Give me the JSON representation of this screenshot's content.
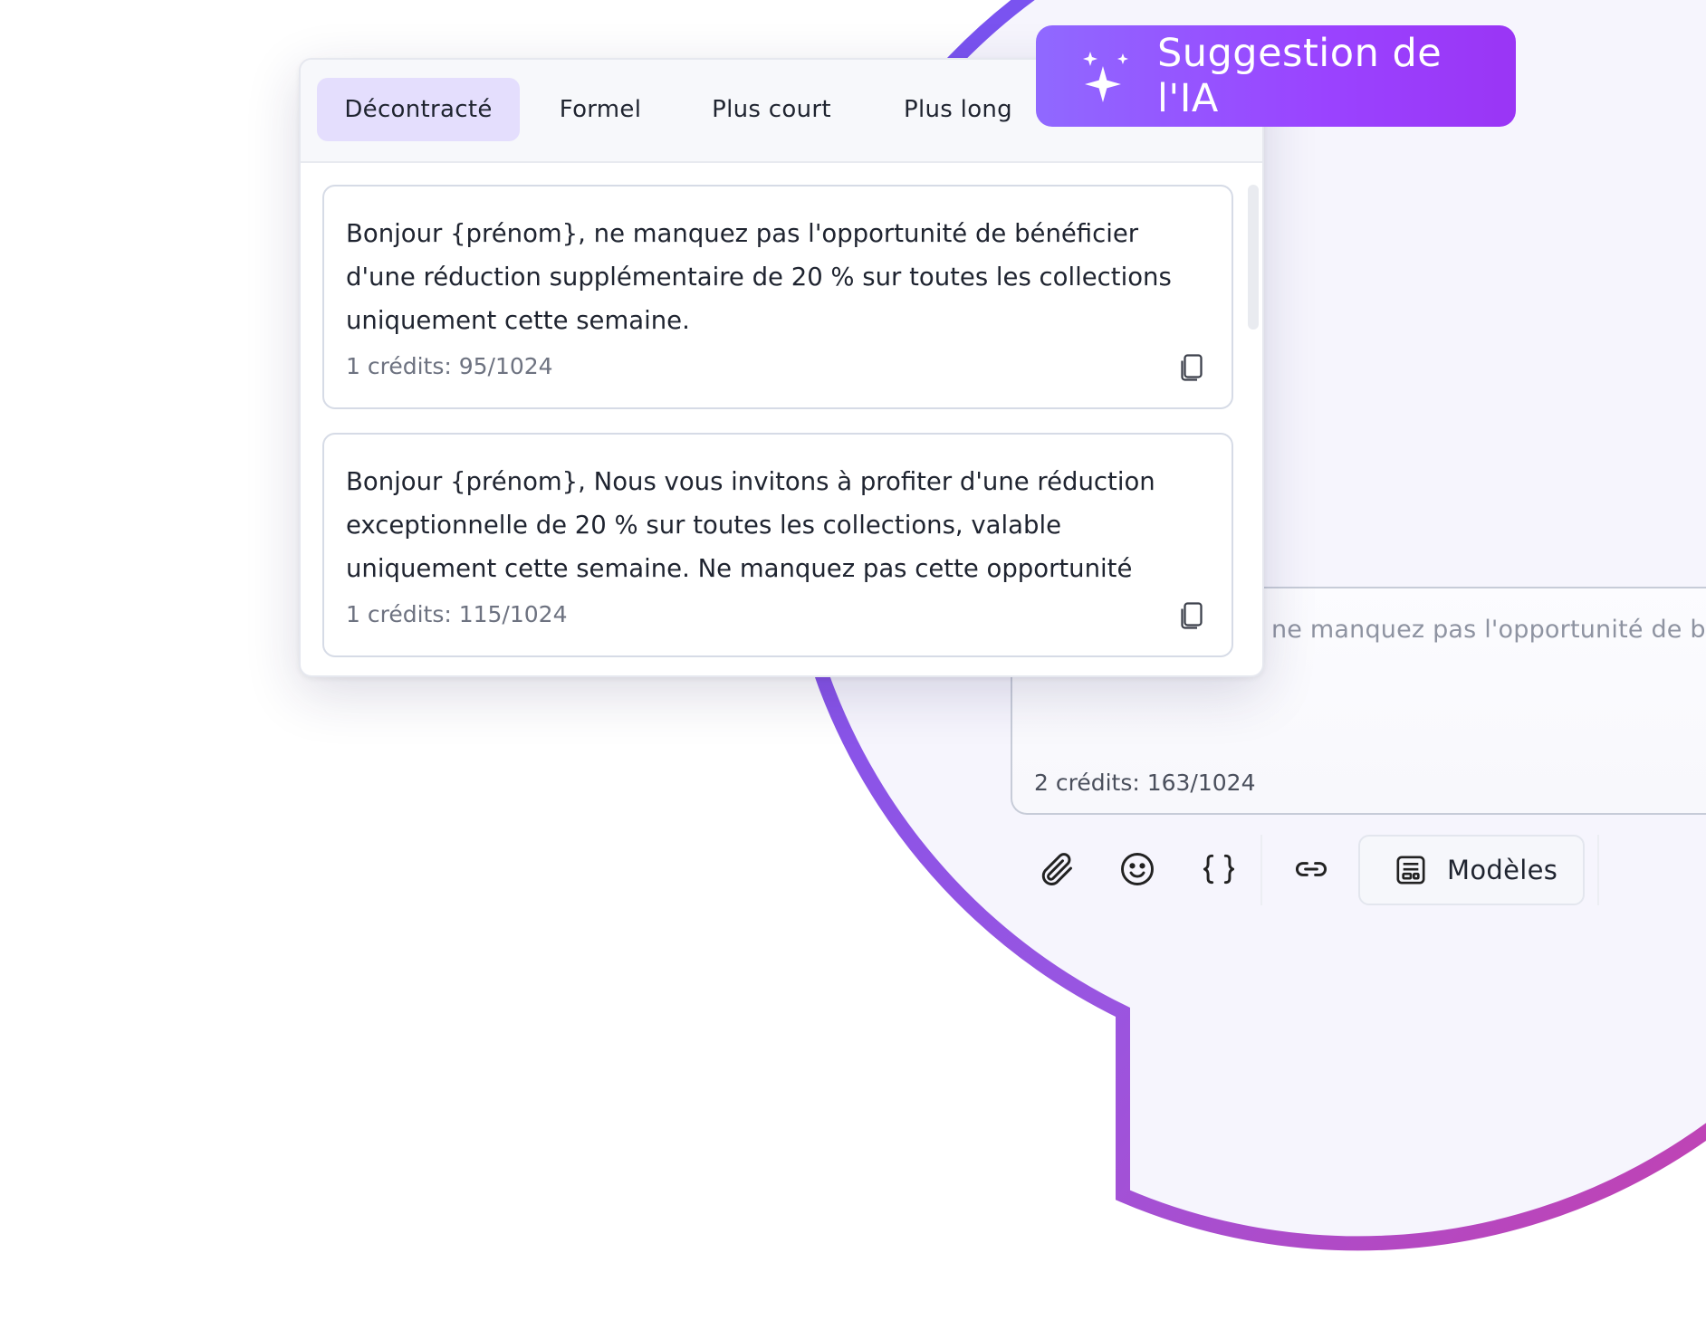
{
  "ai_badge": {
    "label": "Suggestion de l'IA",
    "icon": "sparkles-icon"
  },
  "tabs": [
    {
      "label": "Décontracté",
      "active": true
    },
    {
      "label": "Formel",
      "active": false
    },
    {
      "label": "Plus court",
      "active": false
    },
    {
      "label": "Plus long",
      "active": false
    }
  ],
  "suggestions": [
    {
      "text": "Bonjour {prénom}, ne manquez pas l'opportunité de bénéficier d'une réduction supplémentaire de 20 % sur toutes les collections uniquement cette semaine.",
      "credits": "1 crédits: 95/1024"
    },
    {
      "text": "Bonjour {prénom}, Nous vous invitons à profiter d'une réduction exceptionnelle de 20 % sur toutes les collections, valable uniquement cette semaine. Ne manquez pas cette opportunité",
      "credits": "1 crédits: 115/1024"
    }
  ],
  "composer": {
    "preview_text": "ne manquez pas l'opportunité de b",
    "credits": "2 crédits: 163/1024"
  },
  "toolbar": {
    "icons": [
      "paperclip-icon",
      "emoji-icon",
      "variable-braces-icon",
      "link-icon",
      "template-icon"
    ],
    "templates_label": "Modèles"
  },
  "colors": {
    "accent_purple": "#9a43ff",
    "active_tab_bg": "#e4defd",
    "gradient_start": "#7a55f2",
    "gradient_end": "#c43aa6"
  }
}
